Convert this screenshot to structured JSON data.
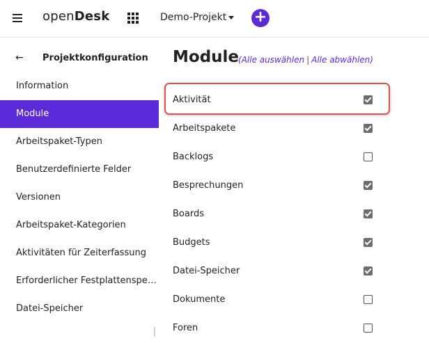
{
  "colors": {
    "accent": "#5b2bd9",
    "highlight": "#d9534f",
    "link": "#5b2bd9"
  },
  "header": {
    "menu_icon": "hamburger-icon",
    "logo_light": "open",
    "logo_bold": "Desk",
    "apps_icon": "grid-icon",
    "project": "Demo-Projekt",
    "add_symbol": "+"
  },
  "sidebar": {
    "back_icon": "←",
    "title": "Projektkonfiguration",
    "items": [
      {
        "label": "Information",
        "active": false
      },
      {
        "label": "Module",
        "active": true
      },
      {
        "label": "Arbeitspaket-Typen",
        "active": false
      },
      {
        "label": "Benutzerdefinierte Felder",
        "active": false
      },
      {
        "label": "Versionen",
        "active": false
      },
      {
        "label": "Arbeitspaket-Kategorien",
        "active": false
      },
      {
        "label": "Aktivitäten für Zeiterfassung",
        "active": false
      },
      {
        "label": "Erforderlicher Festplattenspeicher",
        "active": false
      },
      {
        "label": "Datei-Speicher",
        "active": false
      }
    ]
  },
  "main": {
    "title": "Module",
    "open_paren": "(",
    "select_all": "Alle auswählen",
    "separator": "|",
    "deselect_all": "Alle abwählen",
    "close_paren": ")",
    "modules": [
      {
        "label": "Aktivität",
        "checked": true
      },
      {
        "label": "Arbeitspakete",
        "checked": true
      },
      {
        "label": "Backlogs",
        "checked": false
      },
      {
        "label": "Besprechungen",
        "checked": true
      },
      {
        "label": "Boards",
        "checked": true
      },
      {
        "label": "Budgets",
        "checked": true
      },
      {
        "label": "Datei-Speicher",
        "checked": true
      },
      {
        "label": "Dokumente",
        "checked": false
      },
      {
        "label": "Foren",
        "checked": false
      }
    ]
  }
}
